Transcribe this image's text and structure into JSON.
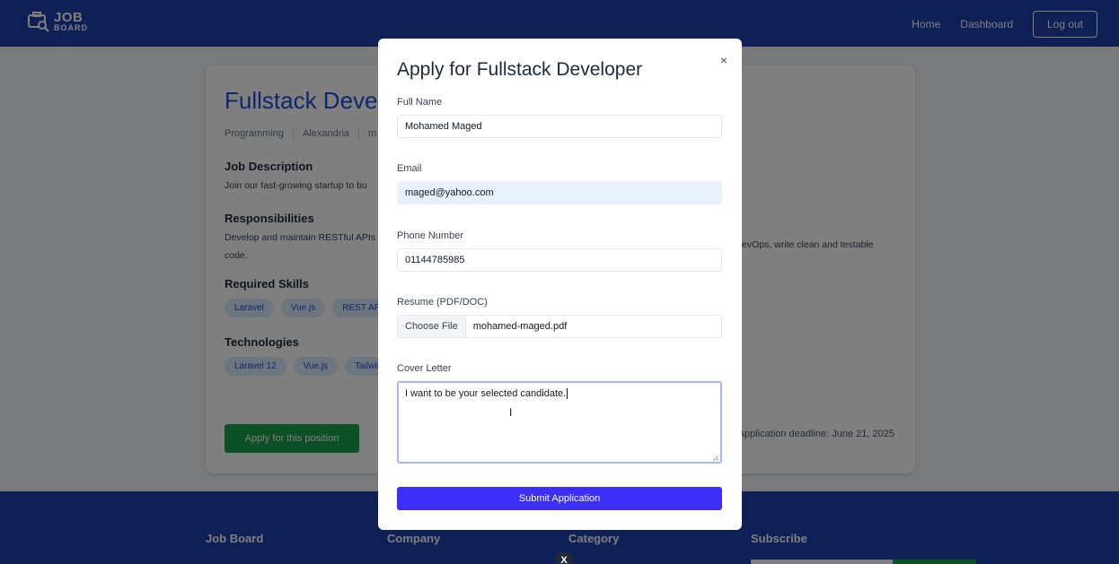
{
  "navbar": {
    "logo_line1": "JOB",
    "logo_line2": "BOARD",
    "links": [
      "Home",
      "Dashboard"
    ],
    "logout_label": "Log out"
  },
  "job": {
    "title": "Fullstack Deve",
    "meta": [
      "Programming",
      "Alexandria",
      "m"
    ],
    "description_title": "Job Description",
    "description_text": "Join our fast-growing startup to bu",
    "responsibilities_title": "Responsibilities",
    "responsibilities_text_left": "Develop and maintain RESTful APIs",
    "responsibilities_text_right": "evOps, write clean and testable",
    "responsibilities_text_line2": "code.",
    "skills_title": "Required Skills",
    "skills": [
      "Laravel",
      "Vue.js",
      "REST APIs"
    ],
    "technologies_title": "Technologies",
    "technologies": [
      "Laravel 12",
      "Vue.js",
      "Tailwind"
    ],
    "apply_label": "Apply for this position",
    "deadline": "Application deadline: June 21, 2025"
  },
  "footer": {
    "columns": [
      "Job Board",
      "Company",
      "Category",
      "Subscribe"
    ]
  },
  "modal": {
    "title": "Apply for Fullstack Developer",
    "close_symbol": "×",
    "full_name_label": "Full Name",
    "full_name_value": "Mohamed Maged",
    "email_label": "Email",
    "email_value": "maged@yahoo.com",
    "phone_label": "Phone Number",
    "phone_value": "01144785985",
    "resume_label": "Resume (PDF/DOC)",
    "resume_button": "Choose File",
    "resume_file": "mohamed-maged.pdf",
    "cover_label": "Cover Letter",
    "cover_value": "I want to be your selected candidate.",
    "submit_label": "Submit Application"
  },
  "floating_close": "X",
  "colors": {
    "navbar": "#1e40af",
    "title_blue": "#1d4ed8",
    "apply_green": "#16a34a",
    "submit_indigo": "#3b2ff5",
    "autofill_bg": "#e8f0fe"
  }
}
